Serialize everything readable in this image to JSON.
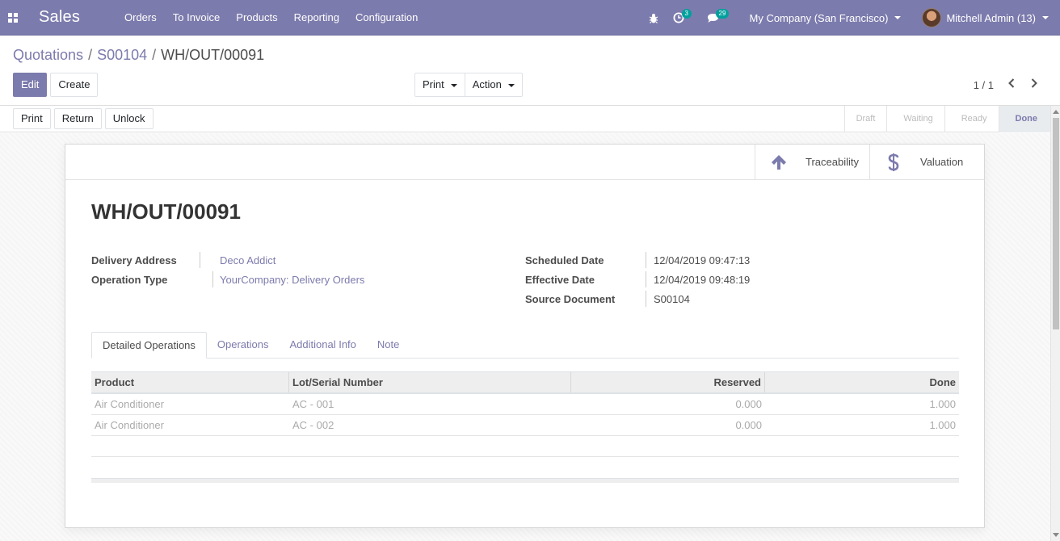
{
  "navbar": {
    "app_name": "Sales",
    "menu": [
      "Orders",
      "To Invoice",
      "Products",
      "Reporting",
      "Configuration"
    ],
    "activity_count": "3",
    "message_count": "29",
    "company": "My Company (San Francisco)",
    "user": "Mitchell Admin (13)"
  },
  "breadcrumb": {
    "item1": "Quotations",
    "item2": "S00104",
    "current": "WH/OUT/00091",
    "separator": "/"
  },
  "control": {
    "edit_label": "Edit",
    "create_label": "Create",
    "print_label": "Print",
    "action_label": "Action",
    "pager": "1 / 1"
  },
  "statusbar": {
    "actions": [
      "Print",
      "Return",
      "Unlock"
    ],
    "stages": [
      "Draft",
      "Waiting",
      "Ready",
      "Done"
    ],
    "active_stage": "Done"
  },
  "smart_buttons": {
    "traceability": "Traceability",
    "valuation": "Valuation"
  },
  "record": {
    "title": "WH/OUT/00091",
    "delivery_address_label": "Delivery Address",
    "delivery_address": "Deco Addict",
    "operation_type_label": "Operation Type",
    "operation_type": "YourCompany: Delivery Orders",
    "scheduled_date_label": "Scheduled Date",
    "scheduled_date": "12/04/2019 09:47:13",
    "effective_date_label": "Effective Date",
    "effective_date": "12/04/2019 09:48:19",
    "source_document_label": "Source Document",
    "source_document": "S00104"
  },
  "tabs": [
    "Detailed Operations",
    "Operations",
    "Additional Info",
    "Note"
  ],
  "table": {
    "headers": [
      "Product",
      "Lot/Serial Number",
      "Reserved",
      "Done"
    ],
    "rows": [
      [
        "Air Conditioner",
        "AC - 001",
        "0.000",
        "1.000"
      ],
      [
        "Air Conditioner",
        "AC - 002",
        "0.000",
        "1.000"
      ]
    ]
  },
  "colors": {
    "brand": "#7c7bad",
    "badge": "#00a09d"
  }
}
